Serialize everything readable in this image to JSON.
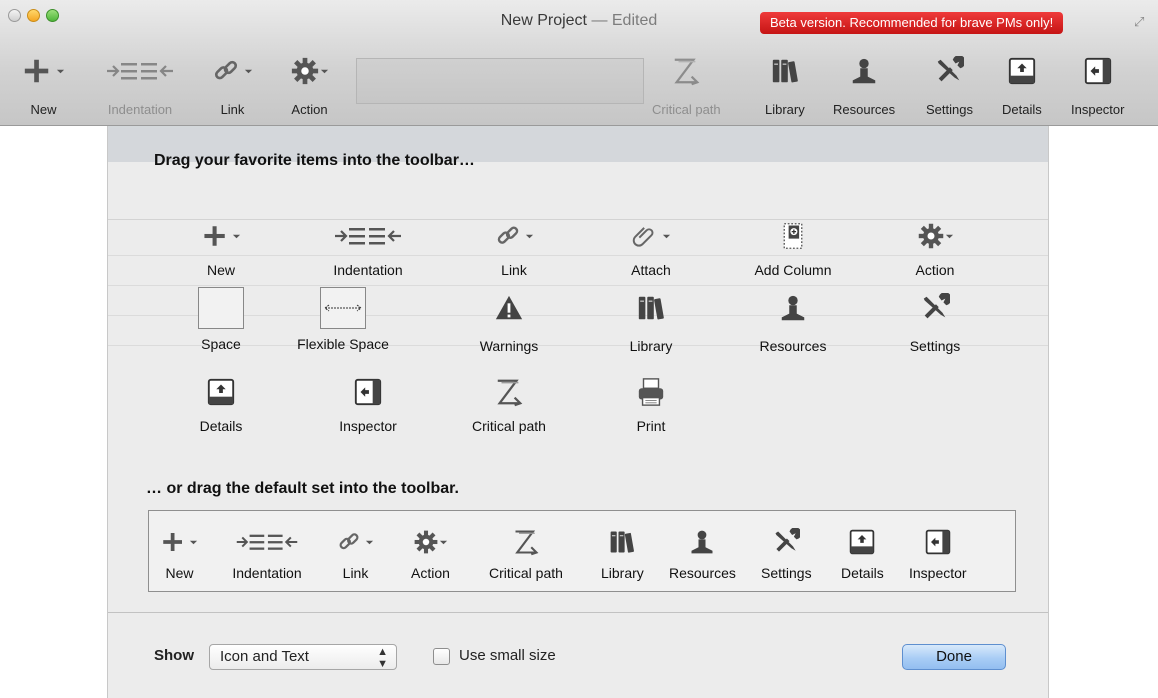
{
  "window": {
    "title": "New Project",
    "edited": "— Edited",
    "beta_badge": "Beta version. Recommended for brave PMs only!"
  },
  "toolbar": {
    "new": "New",
    "indentation": "Indentation",
    "link": "Link",
    "action": "Action",
    "critical_path": "Critical path",
    "library": "Library",
    "resources": "Resources",
    "settings": "Settings",
    "details": "Details",
    "inspector": "Inspector"
  },
  "sheet": {
    "drag_title": "Drag your favorite items into the toolbar…",
    "items": {
      "new": "New",
      "indentation": "Indentation",
      "link": "Link",
      "attach": "Attach",
      "add_column": "Add Column",
      "action": "Action",
      "space": "Space",
      "flexible_space": "Flexible Space",
      "warnings": "Warnings",
      "library": "Library",
      "resources": "Resources",
      "settings": "Settings",
      "details": "Details",
      "inspector": "Inspector",
      "critical_path": "Critical path",
      "print": "Print"
    },
    "default_title": "… or drag the default set into the toolbar.",
    "default_set": {
      "new": "New",
      "indentation": "Indentation",
      "link": "Link",
      "action": "Action",
      "critical_path": "Critical path",
      "library": "Library",
      "resources": "Resources",
      "settings": "Settings",
      "details": "Details",
      "inspector": "Inspector"
    },
    "footer": {
      "show_label": "Show",
      "show_value": "Icon and Text",
      "small_size_label": "Use small size",
      "done_label": "Done"
    }
  }
}
